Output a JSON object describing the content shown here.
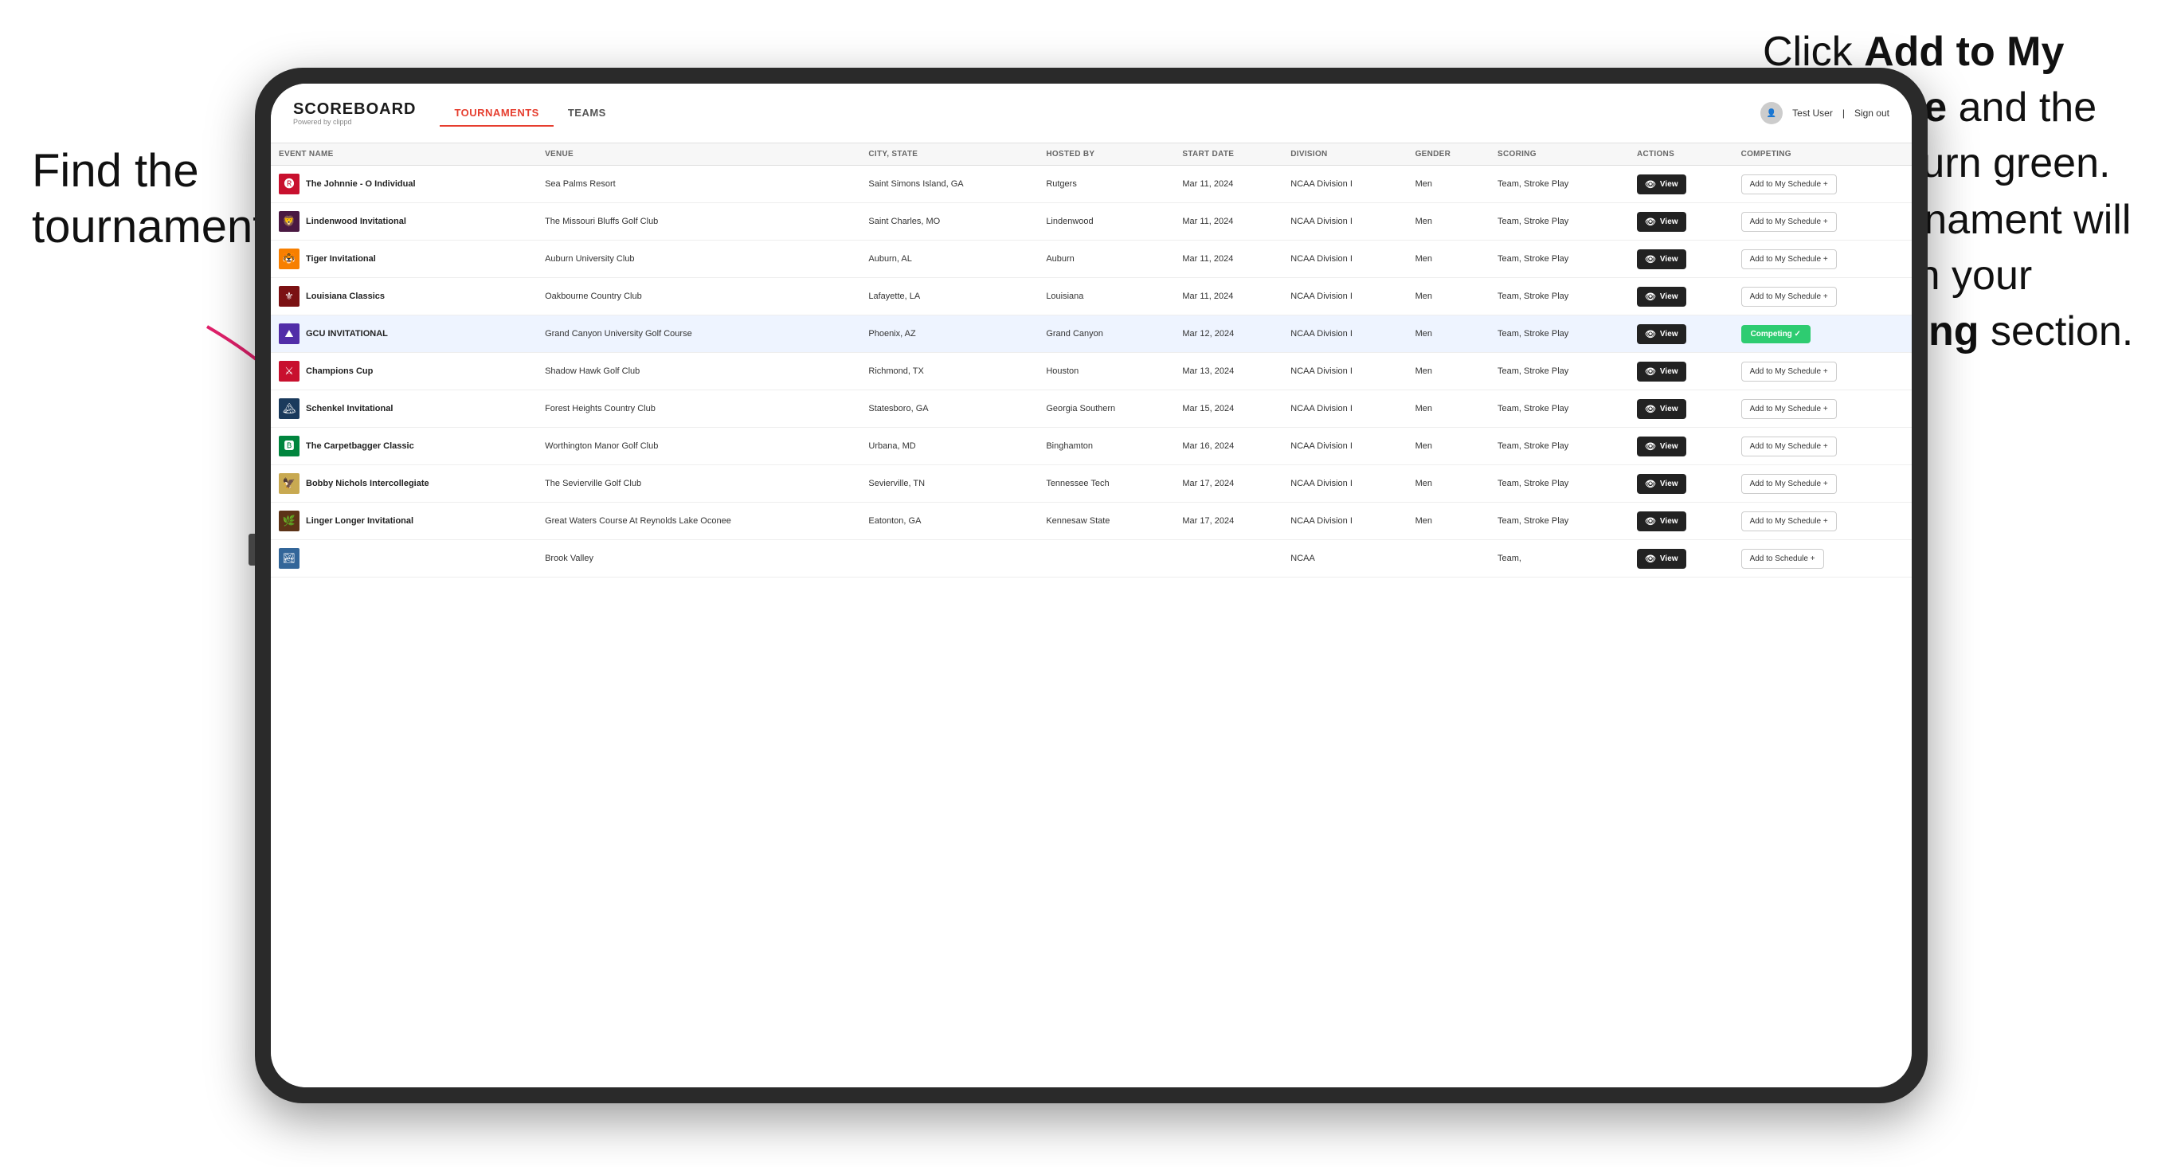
{
  "annotations": {
    "left": "Find the tournament.",
    "right_line1": "Click ",
    "right_bold1": "Add to My Schedule",
    "right_line2": " and the box will turn green. This tournament will now be in your ",
    "right_bold2": "Competing",
    "right_line3": " section."
  },
  "header": {
    "logo": "SCOREBOARD",
    "logo_sub": "Powered by clippd",
    "nav": [
      "TOURNAMENTS",
      "TEAMS"
    ],
    "active_nav": "TOURNAMENTS",
    "user": "Test User",
    "sign_out": "Sign out"
  },
  "table": {
    "columns": [
      "EVENT NAME",
      "VENUE",
      "CITY, STATE",
      "HOSTED BY",
      "START DATE",
      "DIVISION",
      "GENDER",
      "SCORING",
      "ACTIONS",
      "COMPETING"
    ],
    "rows": [
      {
        "logo": "🅡",
        "logo_bg": "#c8102e",
        "name": "The Johnnie - O Individual",
        "venue": "Sea Palms Resort",
        "city_state": "Saint Simons Island, GA",
        "hosted_by": "Rutgers",
        "start_date": "Mar 11, 2024",
        "division": "NCAA Division I",
        "gender": "Men",
        "scoring": "Team, Stroke Play",
        "competing_status": "add",
        "competing_label": "Add to My Schedule +"
      },
      {
        "logo": "🦁",
        "logo_bg": "#4a1942",
        "name": "Lindenwood Invitational",
        "venue": "The Missouri Bluffs Golf Club",
        "city_state": "Saint Charles, MO",
        "hosted_by": "Lindenwood",
        "start_date": "Mar 11, 2024",
        "division": "NCAA Division I",
        "gender": "Men",
        "scoring": "Team, Stroke Play",
        "competing_status": "add",
        "competing_label": "Add to My Schedule +"
      },
      {
        "logo": "🐯",
        "logo_bg": "#f77f00",
        "name": "Tiger Invitational",
        "venue": "Auburn University Club",
        "city_state": "Auburn, AL",
        "hosted_by": "Auburn",
        "start_date": "Mar 11, 2024",
        "division": "NCAA Division I",
        "gender": "Men",
        "scoring": "Team, Stroke Play",
        "competing_status": "add",
        "competing_label": "Add to My Schedule +"
      },
      {
        "logo": "⚜",
        "logo_bg": "#7b1113",
        "name": "Louisiana Classics",
        "venue": "Oakbourne Country Club",
        "city_state": "Lafayette, LA",
        "hosted_by": "Louisiana",
        "start_date": "Mar 11, 2024",
        "division": "NCAA Division I",
        "gender": "Men",
        "scoring": "Team, Stroke Play",
        "competing_status": "add",
        "competing_label": "Add to My Schedule +"
      },
      {
        "logo": "⛰",
        "logo_bg": "#512da8",
        "name": "GCU INVITATIONAL",
        "venue": "Grand Canyon University Golf Course",
        "city_state": "Phoenix, AZ",
        "hosted_by": "Grand Canyon",
        "start_date": "Mar 12, 2024",
        "division": "NCAA Division I",
        "gender": "Men",
        "scoring": "Team, Stroke Play",
        "competing_status": "competing",
        "competing_label": "Competing ✓",
        "highlighted": true
      },
      {
        "logo": "⚔",
        "logo_bg": "#c8102e",
        "name": "Champions Cup",
        "venue": "Shadow Hawk Golf Club",
        "city_state": "Richmond, TX",
        "hosted_by": "Houston",
        "start_date": "Mar 13, 2024",
        "division": "NCAA Division I",
        "gender": "Men",
        "scoring": "Team, Stroke Play",
        "competing_status": "add",
        "competing_label": "Add to My Schedule +"
      },
      {
        "logo": "🏔",
        "logo_bg": "#1a3a5c",
        "name": "Schenkel Invitational",
        "venue": "Forest Heights Country Club",
        "city_state": "Statesboro, GA",
        "hosted_by": "Georgia Southern",
        "start_date": "Mar 15, 2024",
        "division": "NCAA Division I",
        "gender": "Men",
        "scoring": "Team, Stroke Play",
        "competing_status": "add",
        "competing_label": "Add to My Schedule +"
      },
      {
        "logo": "🅱",
        "logo_bg": "#00853e",
        "name": "The Carpetbagger Classic",
        "venue": "Worthington Manor Golf Club",
        "city_state": "Urbana, MD",
        "hosted_by": "Binghamton",
        "start_date": "Mar 16, 2024",
        "division": "NCAA Division I",
        "gender": "Men",
        "scoring": "Team, Stroke Play",
        "competing_status": "add",
        "competing_label": "Add to My Schedule +"
      },
      {
        "logo": "🦅",
        "logo_bg": "#c8a951",
        "name": "Bobby Nichols Intercollegiate",
        "venue": "The Sevierville Golf Club",
        "city_state": "Sevierville, TN",
        "hosted_by": "Tennessee Tech",
        "start_date": "Mar 17, 2024",
        "division": "NCAA Division I",
        "gender": "Men",
        "scoring": "Team, Stroke Play",
        "competing_status": "add",
        "competing_label": "Add to My Schedule +"
      },
      {
        "logo": "🌿",
        "logo_bg": "#5c3317",
        "name": "Linger Longer Invitational",
        "venue": "Great Waters Course At Reynolds Lake Oconee",
        "city_state": "Eatonton, GA",
        "hosted_by": "Kennesaw State",
        "start_date": "Mar 17, 2024",
        "division": "NCAA Division I",
        "gender": "Men",
        "scoring": "Team, Stroke Play",
        "competing_status": "add",
        "competing_label": "Add to My Schedule +"
      },
      {
        "logo": "🏞",
        "logo_bg": "#336699",
        "name": "",
        "venue": "Brook Valley",
        "city_state": "",
        "hosted_by": "",
        "start_date": "",
        "division": "NCAA",
        "gender": "",
        "scoring": "Team,",
        "competing_status": "add",
        "competing_label": "Add to Schedule +"
      }
    ]
  }
}
